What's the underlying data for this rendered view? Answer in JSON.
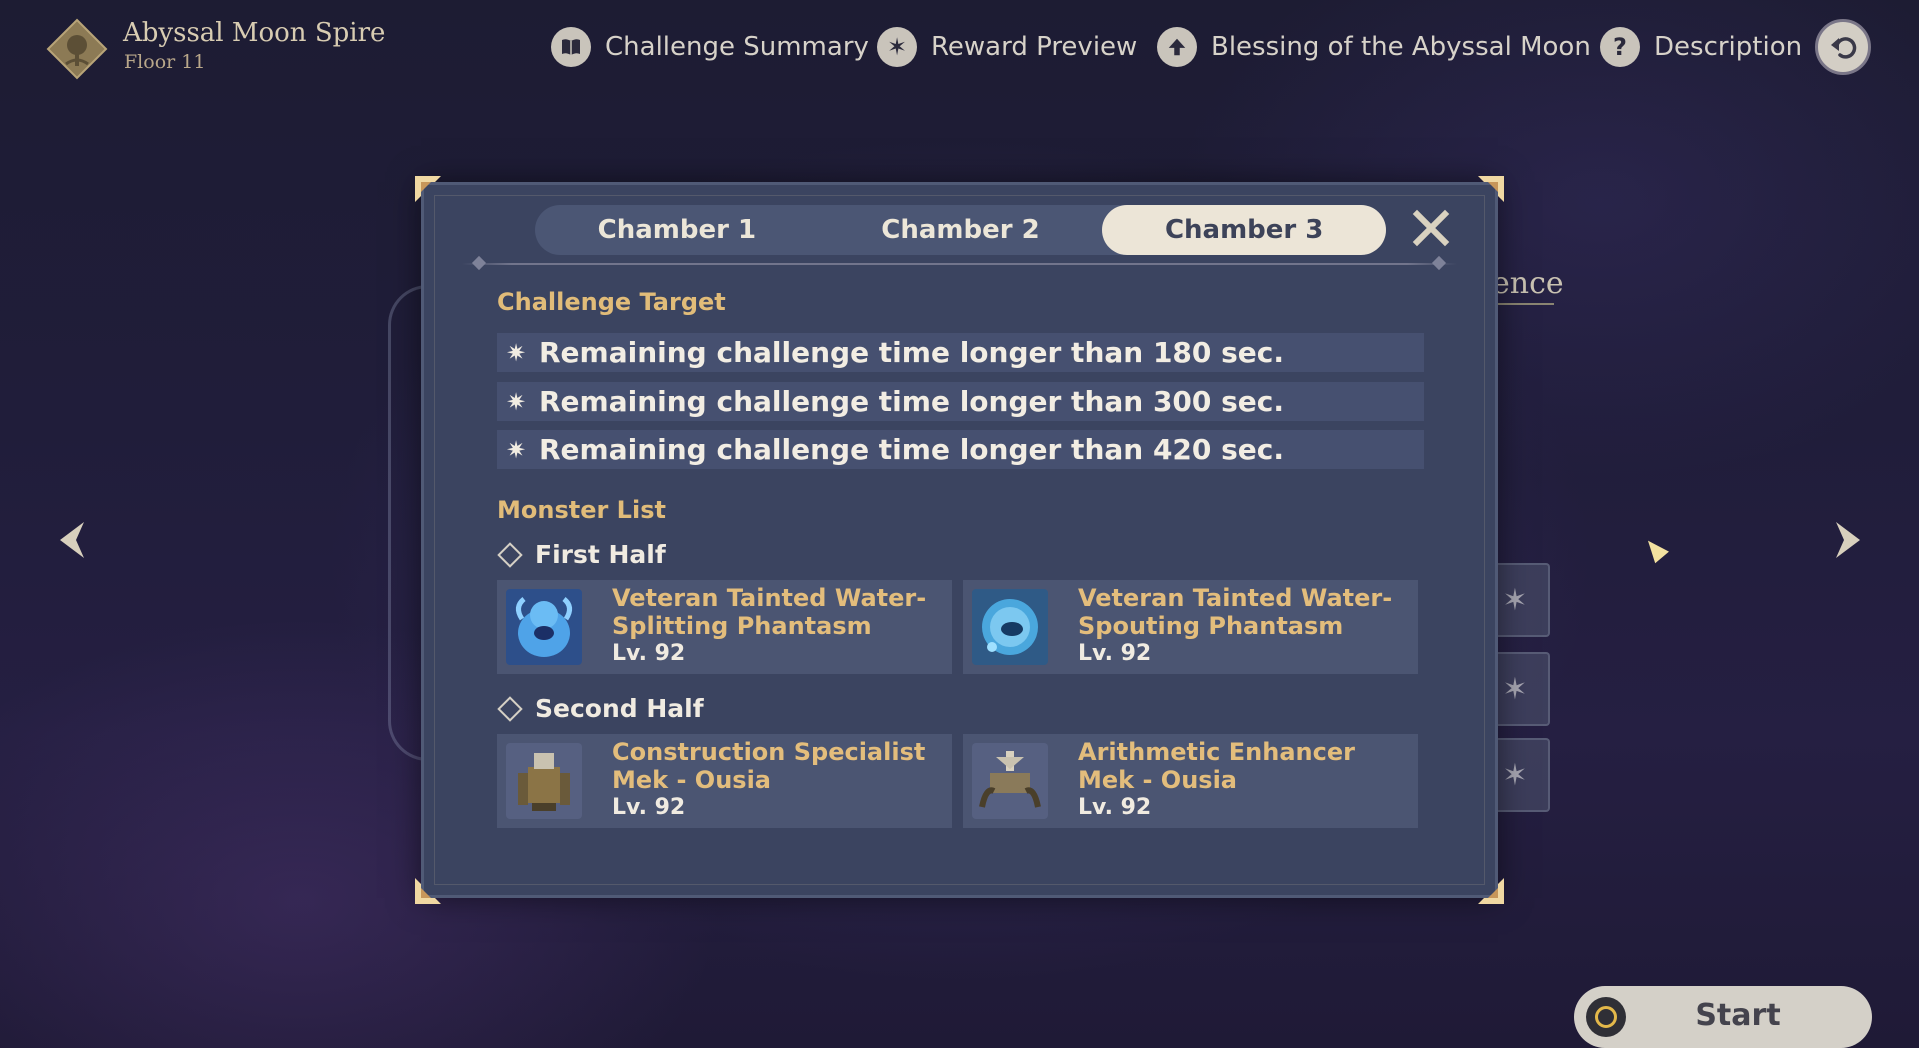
{
  "header": {
    "title": "Abyssal Moon Spire",
    "floor": "Floor 11"
  },
  "nav": {
    "challenge_summary": "Challenge Summary",
    "reward_preview": "Reward Preview",
    "blessing": "Blessing of the Abyssal Moon",
    "description": "Description"
  },
  "background": {
    "partial_text": "ence"
  },
  "modal": {
    "tabs": [
      "Chamber 1",
      "Chamber 2",
      "Chamber 3"
    ],
    "active_tab": "Chamber 3",
    "challenge_target_title": "Challenge Target",
    "targets": [
      "Remaining challenge time longer than 180 sec.",
      "Remaining challenge time longer than 300 sec.",
      "Remaining challenge time longer than 420 sec."
    ],
    "monster_list_title": "Monster List",
    "first_half": {
      "label": "First Half",
      "monsters": [
        {
          "name": "Veteran Tainted Water-Splitting Phantasm",
          "level": "Lv. 92",
          "icon": "water-phantasm-icon"
        },
        {
          "name": "Veteran Tainted Water-Spouting Phantasm",
          "level": "Lv. 92",
          "icon": "water-phantasm-icon"
        }
      ]
    },
    "second_half": {
      "label": "Second Half",
      "monsters": [
        {
          "name": "Construction Specialist Mek - Ousia",
          "level": "Lv. 92",
          "icon": "mek-icon"
        },
        {
          "name": "Arithmetic Enhancer Mek - Ousia",
          "level": "Lv. 92",
          "icon": "mek-icon"
        }
      ]
    }
  },
  "start_button": {
    "label": "Start"
  },
  "colors": {
    "accent_gold": "#e1bc79",
    "panel": "#3b4460",
    "tab_active": "#ece5d7"
  }
}
